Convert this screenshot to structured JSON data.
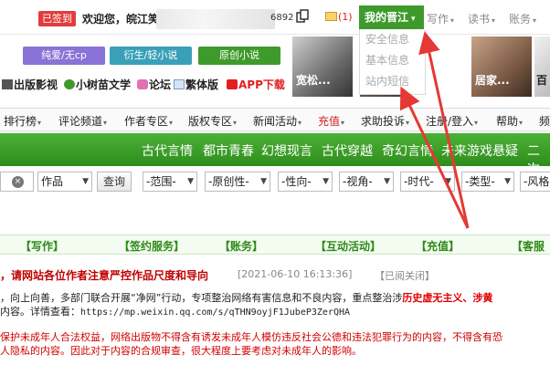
{
  "topbar": {
    "checkin": "已签到",
    "welcome": "欢迎您，",
    "username": "皖江笑",
    "uid_tail": "6892",
    "mail_count": "(1)",
    "myjj": "我的晋江",
    "write": "写作",
    "read": "读书",
    "account": "账务"
  },
  "dropdown": {
    "items": [
      "安全信息",
      "基本信息",
      "站内短信"
    ]
  },
  "channels": [
    "纯爱/无cp",
    "衍生/轻小说",
    "原创小说"
  ],
  "links": [
    "出版影视",
    "小树苗文学",
    "论坛",
    "繁体版",
    "APP下载"
  ],
  "thumbs": [
    "宽松...",
    "居家...",
    "百"
  ],
  "mainnav": [
    "排行榜",
    "评论频道",
    "作者专区",
    "版权专区",
    "新闻活动",
    "充值",
    "求助投诉",
    "注册/登入",
    "帮助",
    "频"
  ],
  "genres": [
    "古代言情",
    "都市青春",
    "幻想现言",
    "古代穿越",
    "奇幻言情",
    "未来游戏悬疑",
    "二次"
  ],
  "search": {
    "type": "作品",
    "button": "查询",
    "filters": [
      "-范围-",
      "-原创性-",
      "-性向-",
      "-视角-",
      "-时代-",
      "-类型-",
      "-风格"
    ]
  },
  "services": [
    "【写作】",
    "【签约服务】",
    "【账务】",
    "【互动活动】",
    "【充值】",
    "【客服"
  ],
  "notice": {
    "title": "，请网站各位作者注意严控作品尺度和导向",
    "date": "[2021-06-10 16:13:36]",
    "closed": "【已阅关闭】",
    "line1": "，向上向善，多部门联合开展“净网”行动，专项整治网络有害信息和不良内容，重点整治涉",
    "line1_hl": "历史虚无主义、涉黄",
    "line2": "内容。详情查看：",
    "url": "https://mp.weixin.qq.com/s/qTHN9oyjF1JubeP3ZerQHA",
    "line3": "保护未成年人合法权益，网络出版物不得含有诱发未成年人模仿违反社会公德和违法犯罪行为的内容，不得含有恐",
    "line4": "人隐私的内容。因此对于内容的合规审查，很大程度上要考虑对未成年人的影响。"
  },
  "colors": {
    "brand_green": "#3f9a2c",
    "genre_bar": "#3a9f28",
    "checkin_red": "#e23c3c",
    "arrow_red": "#e53935",
    "notice_red": "#c00000"
  }
}
